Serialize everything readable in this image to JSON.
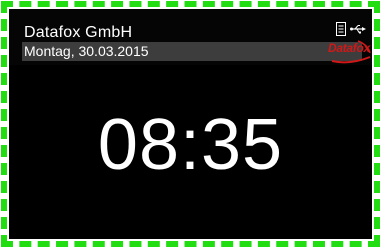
{
  "header": {
    "company": "Datafox GmbH",
    "date": "Montag, 30.03.2015"
  },
  "status_icons": [
    "document-icon",
    "usb-icon"
  ],
  "logo": {
    "text": "Datafox"
  },
  "clock": {
    "time": "08:35"
  },
  "colors": {
    "border_dash": "#22dd11",
    "screen_bg": "#000000",
    "date_bar_bg": "#3d3d3d",
    "text": "#ffffff",
    "logo_red": "#d01818"
  }
}
